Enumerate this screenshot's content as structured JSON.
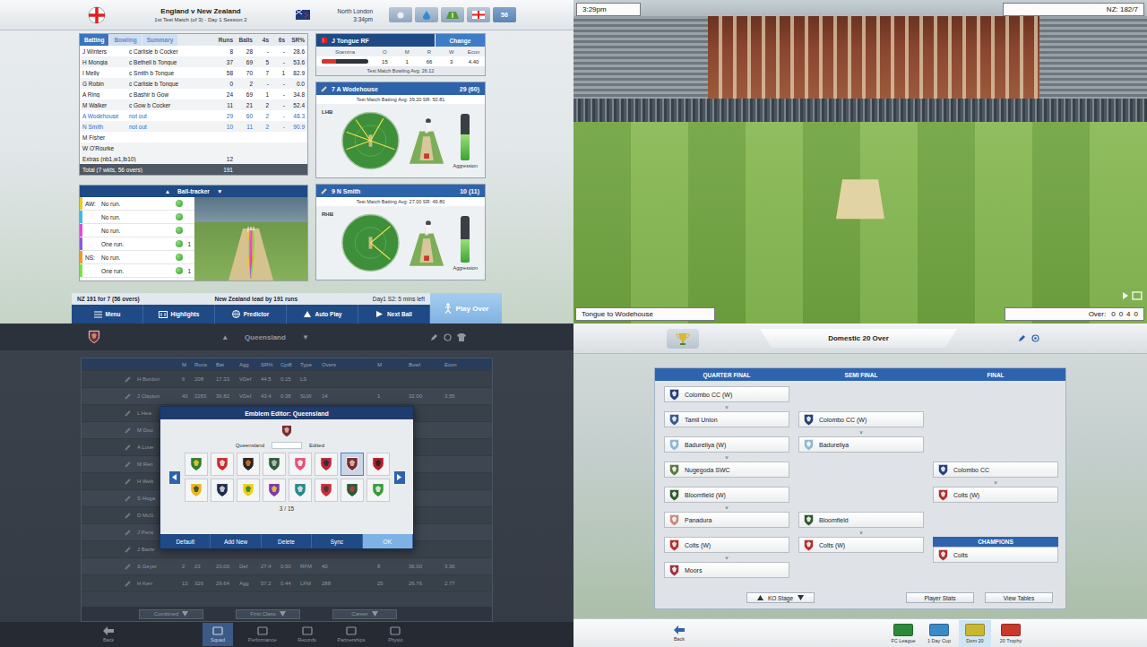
{
  "scorecard_screen": {
    "header": {
      "title": "England v New Zealand",
      "subtitle": "1st Test Match (of 3) - Day 1 Session 2",
      "venue": "North London",
      "time": "3:34pm",
      "overs_badge": "56"
    },
    "tabs": [
      {
        "label": "Batting",
        "selected": true
      },
      {
        "label": "Bowling",
        "selected": false
      },
      {
        "label": "Summary",
        "selected": false
      }
    ],
    "columns": [
      "Runs",
      "Balls",
      "4s",
      "6s",
      "SR%"
    ],
    "rows": [
      {
        "name": "J Winters",
        "how_out": "c Carlisle b Cocker",
        "runs": "8",
        "balls": "28",
        "fours": "-",
        "sixes": "-",
        "strike_rate": "28.6",
        "at_crease": false
      },
      {
        "name": "H Mongia",
        "how_out": "c Bethell b Tongue",
        "runs": "37",
        "balls": "69",
        "fours": "5",
        "sixes": "-",
        "strike_rate": "53.6",
        "at_crease": false
      },
      {
        "name": "I Melly",
        "how_out": "c Smith b Tongue",
        "runs": "58",
        "balls": "70",
        "fours": "7",
        "sixes": "1",
        "strike_rate": "82.9",
        "at_crease": false
      },
      {
        "name": "G Robin",
        "how_out": "c Carlisle b Tongue",
        "runs": "0",
        "balls": "2",
        "fours": "-",
        "sixes": "-",
        "strike_rate": "0.0",
        "at_crease": false
      },
      {
        "name": "A Ring",
        "how_out": "c Bashir b Gow",
        "runs": "24",
        "balls": "69",
        "fours": "1",
        "sixes": "-",
        "strike_rate": "34.8",
        "at_crease": false
      },
      {
        "name": "M Walker",
        "how_out": "c Gow b Cocker",
        "runs": "11",
        "balls": "21",
        "fours": "2",
        "sixes": "-",
        "strike_rate": "52.4",
        "at_crease": false
      },
      {
        "name": "A Wodehouse",
        "how_out": "not out",
        "runs": "29",
        "balls": "60",
        "fours": "2",
        "sixes": "-",
        "strike_rate": "48.3",
        "at_crease": true
      },
      {
        "name": "N Smith",
        "how_out": "not out",
        "runs": "10",
        "balls": "11",
        "fours": "2",
        "sixes": "-",
        "strike_rate": "90.9",
        "at_crease": true
      },
      {
        "name": "M Fisher",
        "how_out": "",
        "runs": "",
        "balls": "",
        "fours": "",
        "sixes": "",
        "strike_rate": "",
        "at_crease": false
      },
      {
        "name": "W O'Rourke",
        "how_out": "",
        "runs": "",
        "balls": "",
        "fours": "",
        "sixes": "",
        "strike_rate": "",
        "at_crease": false
      }
    ],
    "extras": {
      "label": "Extras (nb1,w1,lb10)",
      "runs": "12"
    },
    "total": {
      "label": "Total (7 wkts, 56 overs)",
      "runs": "191"
    },
    "ball_tracker": {
      "title": "Ball-tracker",
      "prev": "▲",
      "next": "▼",
      "balls": [
        {
          "batter": "AW:",
          "result": "No run.",
          "runs": "",
          "color": "#f2c81e"
        },
        {
          "batter": "",
          "result": "No run.",
          "runs": "",
          "color": "#3fb8e8"
        },
        {
          "batter": "",
          "result": "No run.",
          "runs": "",
          "color": "#e04ad8"
        },
        {
          "batter": "",
          "result": "One run.",
          "runs": "1",
          "color": "#8a5ae0"
        },
        {
          "batter": "NS:",
          "result": "No run.",
          "runs": "",
          "color": "#f09a28"
        },
        {
          "batter": "",
          "result": "One run.",
          "runs": "1",
          "color": "#7ee04a"
        }
      ]
    },
    "bowler": {
      "name": "J Tongue RF",
      "change_button": "Change",
      "columns": [
        "Stamina",
        "O",
        "M",
        "R",
        "W",
        "Econ"
      ],
      "overs": "15",
      "maidens": "1",
      "runs": "66",
      "wickets": "3",
      "economy": "4.40",
      "stamina": 0.3,
      "average": "Test Match Bowling Avg: 26.12"
    },
    "batters": [
      {
        "heading": "7 A Wodehouse",
        "score": "29 (60)",
        "stats": "Test Match Batting Avg: 39.20  SR: 50.81",
        "hand": "LHB",
        "aggression": 0.55,
        "aggression_label": "Aggression",
        "shot_angles": [
          200,
          235,
          300,
          20,
          160
        ]
      },
      {
        "heading": "9 N Smith",
        "score": "10 (11)",
        "stats": "Test Match Batting Avg: 27.00  SR: 49.80",
        "hand": "RHB",
        "aggression": 0.5,
        "aggression_label": "Aggression",
        "shot_angles": [
          320,
          40
        ]
      }
    ],
    "status": {
      "score": "NZ 191 for 7  (56 overs)",
      "lead": "New Zealand lead by 191 runs",
      "session": "Day1 S2: 5 mins left"
    },
    "buttons": [
      "Menu",
      "Highlights",
      "Predictor",
      "Auto Play",
      "Next Ball"
    ],
    "play_button": "Play Over"
  },
  "match_view": {
    "clock": "3:29pm",
    "score": "NZ: 182/7",
    "caption": "Tongue to Wodehouse",
    "over_label": "Over:",
    "over_balls": [
      "0",
      "0",
      "4",
      "0"
    ]
  },
  "squad_screen": {
    "team": "Queensland",
    "prev": "▲",
    "next": "▼",
    "columns": [
      "M",
      "Runs",
      "Bat",
      "Agg",
      "SR%",
      "Cpt8",
      "Type",
      "Overs",
      "M",
      "Bowl",
      "Econ"
    ],
    "players": [
      {
        "name": "H Burdon",
        "values": [
          "6",
          "208",
          "17.33",
          "VDef",
          "44.5",
          "0.15",
          "LS",
          "",
          "",
          "",
          ""
        ]
      },
      {
        "name": "J Clayton",
        "values": [
          "40",
          "2283",
          "36.82",
          "VDef",
          "43.4",
          "0.38",
          "SLW",
          "14",
          "1",
          "32.00",
          "3.55"
        ]
      },
      {
        "name": "L Hea",
        "values": [
          "",
          "",
          "",
          "",
          "",
          "",
          "",
          "",
          "",
          "",
          ""
        ]
      },
      {
        "name": "M Dou",
        "values": [
          "",
          "",
          "",
          "",
          "",
          "",
          "",
          "",
          "",
          "",
          ""
        ]
      },
      {
        "name": "A Love",
        "values": [
          "",
          "",
          "",
          "",
          "",
          "",
          "",
          "",
          "",
          "",
          ""
        ]
      },
      {
        "name": "M Ren",
        "values": [
          "",
          "",
          "",
          "",
          "",
          "",
          "",
          "",
          "",
          "",
          ""
        ]
      },
      {
        "name": "H Web",
        "values": [
          "",
          "",
          "",
          "",
          "",
          "",
          "",
          "",
          "",
          "",
          ""
        ]
      },
      {
        "name": "S Hoga",
        "values": [
          "",
          "",
          "",
          "",
          "",
          "",
          "",
          "",
          "",
          "",
          ""
        ]
      },
      {
        "name": "D McG",
        "values": [
          "",
          "",
          "",
          "",
          "",
          "",
          "",
          "",
          "",
          "",
          ""
        ]
      },
      {
        "name": "J Pens",
        "values": [
          "",
          "",
          "",
          "",
          "",
          "",
          "",
          "",
          "",
          "",
          ""
        ]
      },
      {
        "name": "J Bazle",
        "values": [
          "",
          "",
          "",
          "",
          "",
          "",
          "",
          "",
          "",
          "",
          ""
        ]
      },
      {
        "name": "S Geyer",
        "values": [
          "2",
          "23",
          "23.00",
          "Def",
          "27.4",
          "0.50",
          "RFM",
          "40",
          "8",
          "36.00",
          "3.36"
        ]
      },
      {
        "name": "H Kerr",
        "values": [
          "13",
          "326",
          "29.64",
          "Agg",
          "57.2",
          "0.44",
          "LFM",
          "288",
          "25",
          "26.76",
          "2.77"
        ]
      }
    ],
    "filters": [
      "Combined",
      "First Class",
      "Career"
    ],
    "editor": {
      "title": "Emblem Editor: Queensland",
      "current_label": "Queensland",
      "edited_label": "Edited",
      "current_color": "#7a2a36",
      "page": "3 / 15",
      "emblems": [
        {
          "color": "#2f7d32",
          "accent": "#f2d024",
          "selected": false
        },
        {
          "color": "#c62f2f",
          "accent": "#f0f0f0",
          "selected": false
        },
        {
          "color": "#262626",
          "accent": "#e8761e",
          "selected": false
        },
        {
          "color": "#2c5e3c",
          "accent": "#c8c8c8",
          "selected": false
        },
        {
          "color": "#e0557a",
          "accent": "#ffffff",
          "selected": false
        },
        {
          "color": "#b82835",
          "accent": "#1e2a4a",
          "selected": false
        },
        {
          "color": "#7a2a36",
          "accent": "#d8c8a0",
          "selected": true
        },
        {
          "color": "#b01e2a",
          "accent": "#222222",
          "selected": false
        },
        {
          "color": "#e8b820",
          "accent": "#3a3a3a",
          "selected": false
        },
        {
          "color": "#1f2d4f",
          "accent": "#e0e0e0",
          "selected": false
        },
        {
          "color": "#e8d020",
          "accent": "#2f7d32",
          "selected": false
        },
        {
          "color": "#7a3aa8",
          "accent": "#f2d024",
          "selected": false
        },
        {
          "color": "#2a8a8a",
          "accent": "#e8e8e8",
          "selected": false
        },
        {
          "color": "#c8303a",
          "accent": "#3a3a3a",
          "selected": false
        },
        {
          "color": "#2a5a3a",
          "accent": "#c83a3a",
          "selected": false
        },
        {
          "color": "#3a9a3a",
          "accent": "#f0f0f0",
          "selected": false
        }
      ],
      "buttons": [
        {
          "label": "Default",
          "primary": false
        },
        {
          "label": "Add New",
          "primary": false
        },
        {
          "label": "Delete",
          "primary": false
        },
        {
          "label": "Sync",
          "primary": false
        },
        {
          "label": "OK",
          "primary": true
        }
      ]
    },
    "back": "Back",
    "nav": [
      {
        "label": "Squad",
        "selected": true
      },
      {
        "label": "Performance",
        "selected": false
      },
      {
        "label": "Records",
        "selected": false
      },
      {
        "label": "Partnerships",
        "selected": false
      },
      {
        "label": "Physio",
        "selected": false
      }
    ]
  },
  "cup_screen": {
    "title": "Domestic 20 Over",
    "rounds": [
      "QUARTER FINAL",
      "SEMI FINAL",
      "FINAL"
    ],
    "versus": "v",
    "quarter_finals": [
      [
        {
          "name": "Colombo CC (W)",
          "color": "#24407a"
        },
        {
          "name": "Tamil Union",
          "color": "#3a5a8c"
        }
      ],
      [
        {
          "name": "Badureliya (W)",
          "color": "#8fb8d0"
        },
        {
          "name": "Nugegoda SWC",
          "color": "#5a7a3a"
        }
      ],
      [
        {
          "name": "Bloomfield (W)",
          "color": "#2f5a2a"
        },
        {
          "name": "Panadura",
          "color": "#c88a80"
        }
      ],
      [
        {
          "name": "Colts (W)",
          "color": "#b03030"
        },
        {
          "name": "Moors",
          "color": "#a03040"
        }
      ]
    ],
    "semi_finals": [
      [
        {
          "name": "Colombo CC (W)",
          "color": "#24407a"
        },
        {
          "name": "Badureliya",
          "color": "#8fb8d0"
        }
      ],
      [
        {
          "name": "Bloomfield",
          "color": "#2f5a2a"
        },
        {
          "name": "Colts (W)",
          "color": "#b03030"
        }
      ]
    ],
    "final": [
      {
        "name": "Colombo CC",
        "color": "#24407a"
      },
      {
        "name": "Colts (W)",
        "color": "#b03030"
      }
    ],
    "champions_label": "CHAMPIONS",
    "champion": {
      "name": "Colts",
      "color": "#b03030"
    },
    "stage_select": "KO Stage",
    "buttons": [
      "Player Stats",
      "View Tables"
    ],
    "back": "Back",
    "competitions": [
      {
        "label": "FC League",
        "selected": false,
        "color": "#2a8a3a"
      },
      {
        "label": "1 Day Cup",
        "selected": false,
        "color": "#3a8ac8"
      },
      {
        "label": "Dom 20",
        "selected": true,
        "color": "#c8b830"
      },
      {
        "label": "20 Trophy",
        "selected": false,
        "color": "#c83a2a"
      }
    ]
  }
}
